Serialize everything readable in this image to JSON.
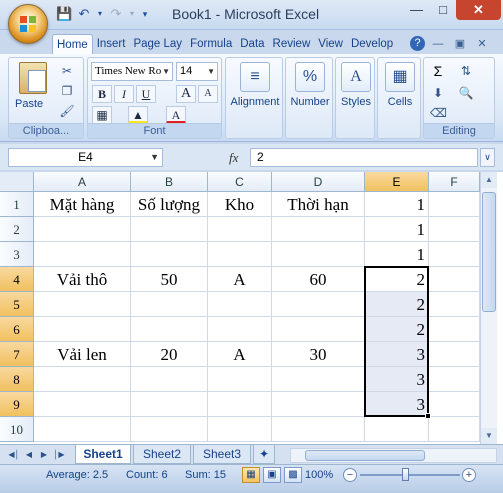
{
  "window": {
    "title": "Book1 - Microsoft Excel",
    "minimize": "—",
    "maximize": "□",
    "close": "✕"
  },
  "qat": {
    "save_icon": "save-icon",
    "undo_icon": "undo-icon",
    "redo_icon": "redo-icon"
  },
  "tabs": [
    {
      "label": "Home",
      "active": true
    },
    {
      "label": "Insert"
    },
    {
      "label": "Page Lay"
    },
    {
      "label": "Formula"
    },
    {
      "label": "Data"
    },
    {
      "label": "Review"
    },
    {
      "label": "View"
    },
    {
      "label": "Develop"
    }
  ],
  "ribbon": {
    "clipboard": {
      "paste_label": "Paste",
      "group_label": "Clipboa..."
    },
    "font": {
      "name": "Times New Ro",
      "size": "14",
      "group_label": "Font",
      "bold": "B",
      "italic": "I",
      "underline": "U",
      "grow": "A",
      "shrink": "A"
    },
    "alignment": {
      "label": "Alignment"
    },
    "number": {
      "label": "Number",
      "symbol": "%"
    },
    "styles": {
      "label": "Styles"
    },
    "cells": {
      "label": "Cells"
    },
    "editing": {
      "label": "Editing",
      "sum_symbol": "Σ"
    }
  },
  "formula_bar": {
    "name_box": "E4",
    "fx": "fx",
    "value": "2"
  },
  "columns": [
    "A",
    "B",
    "C",
    "D",
    "E",
    "F"
  ],
  "rows": [
    "1",
    "2",
    "3",
    "4",
    "5",
    "6",
    "7",
    "8",
    "9",
    "10"
  ],
  "cells": {
    "A1": "Mặt hàng",
    "B1": "Số lượng",
    "C1": "Kho",
    "D1": "Thời hạn",
    "E1": "1",
    "E2": "1",
    "E3": "1",
    "A4": "Vải thô",
    "B4": "50",
    "C4": "A",
    "D4": "60",
    "E4": "2",
    "E5": "2",
    "E6": "2",
    "A7": "Vải len",
    "B7": "20",
    "C7": "A",
    "D7": "30",
    "E7": "3",
    "E8": "3",
    "E9": "3"
  },
  "selection": {
    "active_cell": "E4",
    "range": "E4:E9",
    "color": "#000000"
  },
  "sheets": [
    {
      "label": "Sheet1",
      "active": true
    },
    {
      "label": "Sheet2"
    },
    {
      "label": "Sheet3"
    }
  ],
  "status": {
    "average": "Average: 2.5",
    "count": "Count: 6",
    "sum": "Sum: 15",
    "zoom": "100%"
  },
  "colors": {
    "ribbon_bg": "#dbe8f7",
    "selection_header": "#f1c15f",
    "close_button": "#c7452f"
  }
}
